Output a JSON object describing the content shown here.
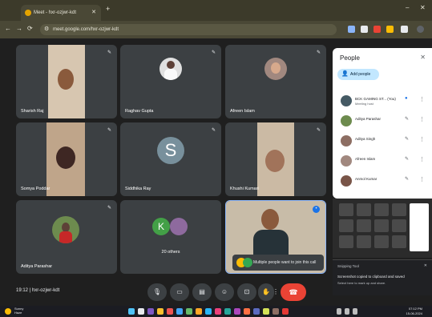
{
  "browser": {
    "tab_title": "Meet - hxr-ozjwr-kdt",
    "tab_close": "✕",
    "new_tab": "+",
    "url": "meet.google.com/hxr-ozjwr-kdt",
    "min": "–",
    "close": "✕",
    "back": "←",
    "forward": "→",
    "reload": "⟳"
  },
  "tiles": [
    {
      "name": "Sharish Raj"
    },
    {
      "name": "Raghav Gupta"
    },
    {
      "name": "Afreen Islam"
    },
    {
      "name": "Somya Poddar"
    },
    {
      "name": "Siddhika Ray",
      "letter": "S"
    },
    {
      "name": "Khushi Kumari"
    },
    {
      "name": "Aditya Parashar"
    },
    {
      "name": "20 others",
      "letter": "K"
    },
    {
      "name": ""
    }
  ],
  "notification": {
    "text": "Multiple people want to join this call"
  },
  "toolbar": {
    "time": "19:12 | hxr-ozjwr-kdt",
    "mic": "🎙",
    "more": "⋮",
    "end": "☎"
  },
  "people_panel": {
    "title": "People",
    "close": "✕",
    "add_people": "Add people",
    "participants": [
      {
        "name": "BCK GAMING ST... (You)",
        "sub": "Meeting host"
      },
      {
        "name": "Aditya Parashar",
        "sub": ""
      },
      {
        "name": "Aditya Singh",
        "sub": ""
      },
      {
        "name": "Afreen Islam",
        "sub": ""
      },
      {
        "name": "Anmol Kumar",
        "sub": ""
      }
    ]
  },
  "toast": {
    "title": "Snipping Tool",
    "message": "Screenshot copied to clipboard and saved",
    "sub": "Select here to mark up and share.",
    "close": "✕"
  },
  "taskbar": {
    "weather_line1": "Sunny",
    "weather_line2": "Haze",
    "time": "07:12 PM",
    "date": "15-06-2024"
  }
}
